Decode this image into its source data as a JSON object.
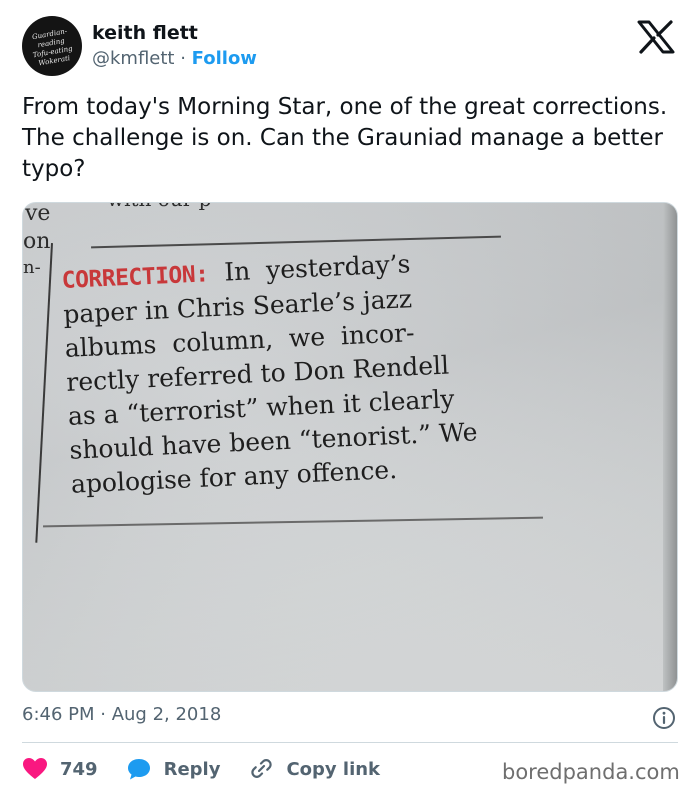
{
  "author": {
    "avatar_lines": [
      "Guardian-reading",
      "Tofu-eating",
      "Wokerati"
    ],
    "name": "keith flett",
    "handle": "@kmflett",
    "separator": " · ",
    "follow_label": "Follow"
  },
  "tweet": {
    "text": "From today's Morning Star, one of the great corrections. The challenge is on. Can the Grauniad manage a better typo?",
    "time": "6:46 PM",
    "meta_separator": " · ",
    "date": "Aug 2, 2018"
  },
  "clipping": {
    "label": "CORRECTION:",
    "line1_rest": "  In  yesterday’s",
    "line2": "paper in Chris Searle’s jazz",
    "line3": "albums  column,  we  incor-",
    "line4": "rectly referred to Don Rendell",
    "line5": "as a “terrorist” when it clearly",
    "line6": "should have been “tenorist.” We",
    "line7": "apologise for any offence.",
    "top_fragment": "with our p",
    "edge_fragments": [
      "ve",
      "on",
      "n-"
    ]
  },
  "actions": {
    "like_count": "749",
    "reply_label": "Reply",
    "copy_label": "Copy link"
  },
  "watermark": "boredpanda.com",
  "colors": {
    "like": "#f91880",
    "reply": "#1d9bf0",
    "follow": "#1d9bf0",
    "correction_red": "#c8383a"
  },
  "icons": {
    "brand": "x-logo-icon",
    "info": "info-icon",
    "like": "heart-icon",
    "reply": "speech-bubble-icon",
    "copy": "link-icon"
  }
}
